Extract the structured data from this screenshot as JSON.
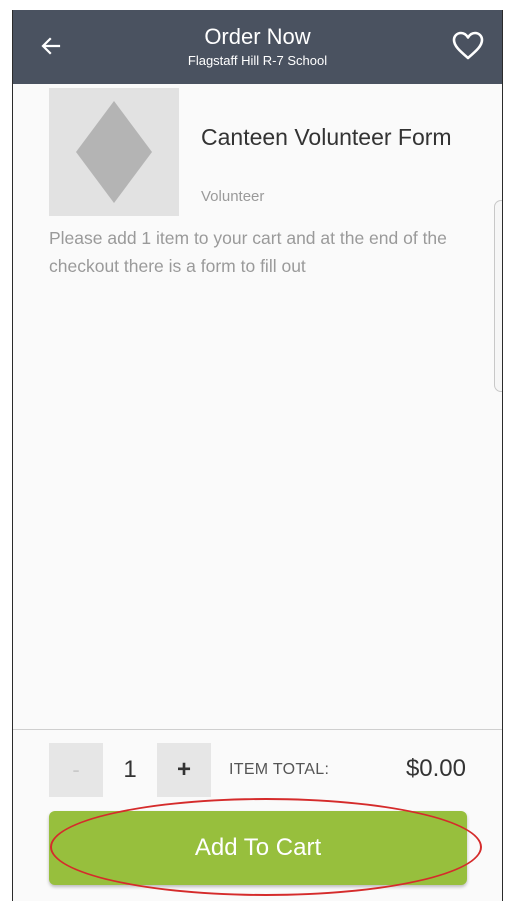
{
  "appbar": {
    "title": "Order Now",
    "subtitle": "Flagstaff Hill R-7 School",
    "back_icon": "arrow-left-icon",
    "favorite_icon": "heart-outline-icon"
  },
  "product": {
    "title": "Canteen Volunteer Form",
    "category": "Volunteer",
    "thumbnail_icon": "diamond-placeholder-icon",
    "description": "Please add 1 item to your cart and at the end of the checkout there is a form to fill out"
  },
  "order": {
    "minus_label": "-",
    "quantity": "1",
    "plus_label": "+",
    "total_label": "ITEM TOTAL:",
    "total_value": "$0.00",
    "add_to_cart_label": "Add To Cart"
  },
  "colors": {
    "appbar": "#4a5260",
    "button": "#97bf3d",
    "highlight": "#d52b2b"
  }
}
